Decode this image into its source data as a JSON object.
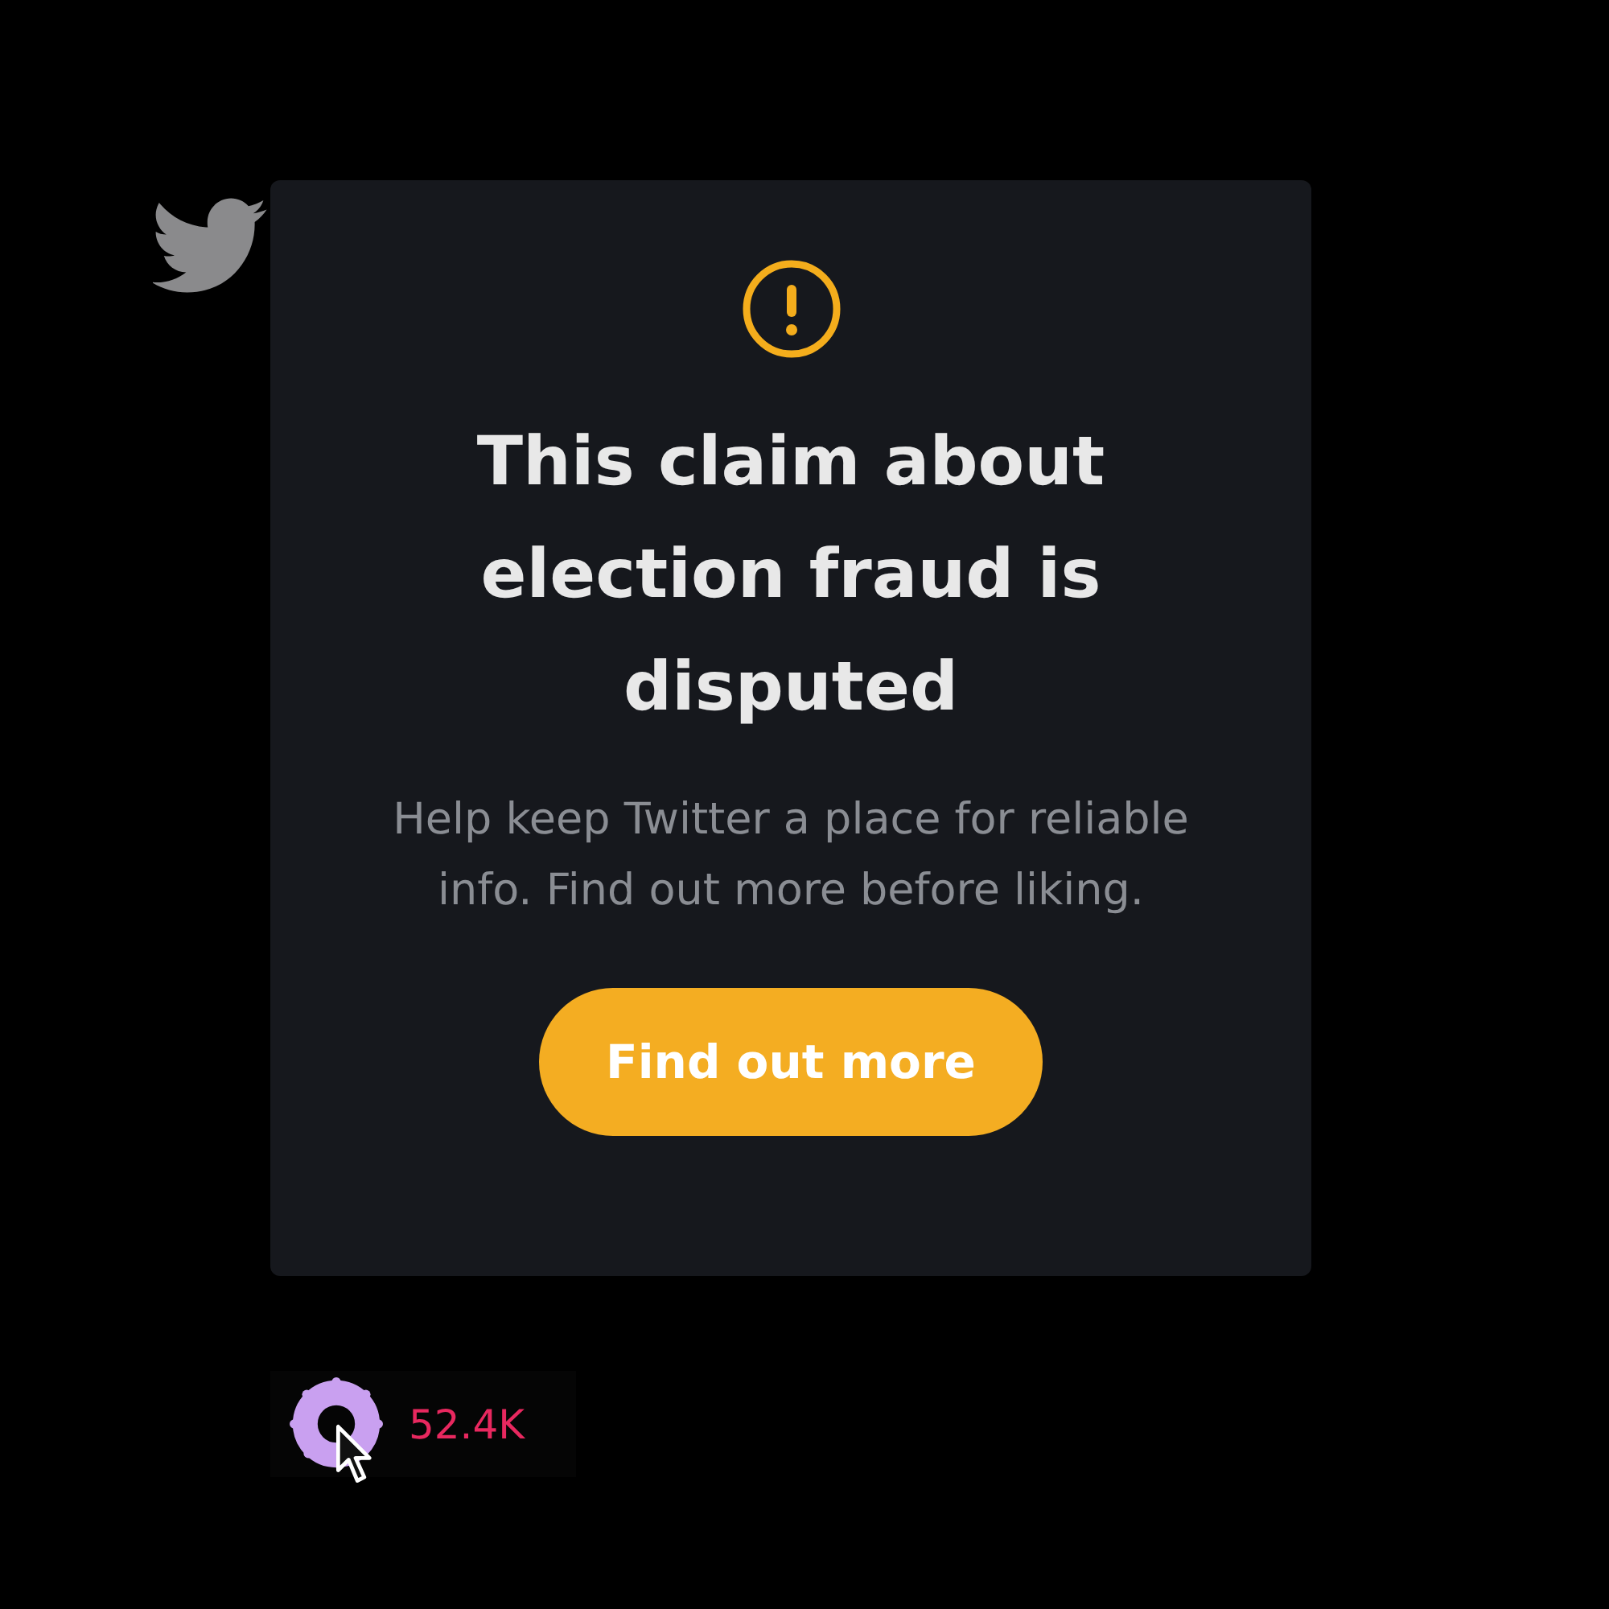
{
  "notice": {
    "title": "This claim about election fraud is disputed",
    "message": "Help keep Twitter a place for reliable info. Find out more before liking.",
    "button": "Find out more"
  },
  "like": {
    "count": "52.4K"
  }
}
